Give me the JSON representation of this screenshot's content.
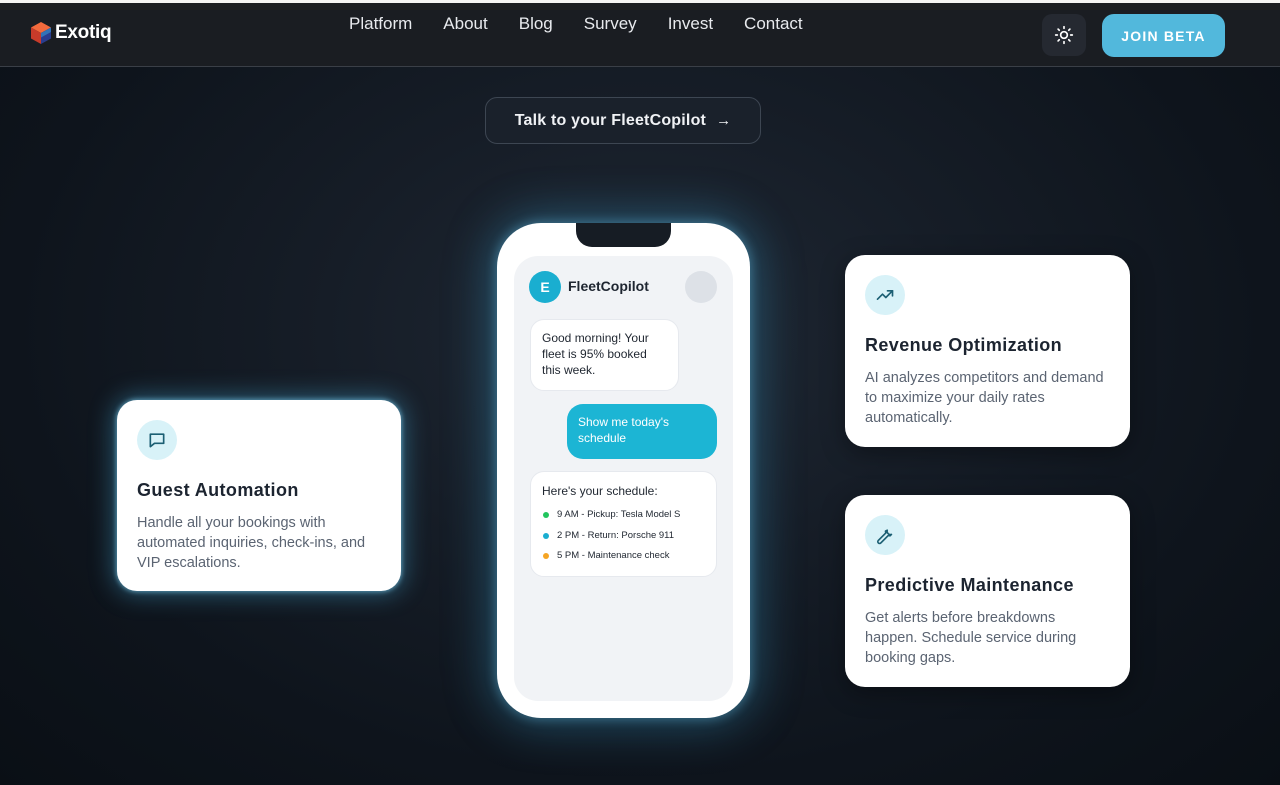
{
  "nav": {
    "brand": "Exotiq",
    "links": [
      "Platform",
      "About",
      "Blog",
      "Survey",
      "Invest",
      "Contact"
    ],
    "theme_icon": "sun-icon",
    "cta_label": "JOIN BETA"
  },
  "hero": {
    "cta_label": "Talk to your FleetCopilot",
    "cta_icon": "arrow-right-icon"
  },
  "phone": {
    "avatar_letter": "E",
    "bot_name": "FleetCopilot",
    "messages": [
      {
        "from": "bot",
        "text": "Good morning! Your fleet is 95% booked this week."
      },
      {
        "from": "user",
        "text": "Show me today's schedule"
      }
    ],
    "schedule": {
      "title": "Here's your schedule:",
      "items": [
        {
          "text": "9 AM - Pickup: Tesla Model S",
          "color": "#22c55e"
        },
        {
          "text": "2 PM - Return: Porsche 911",
          "color": "#1aaed0"
        },
        {
          "text": "5 PM - Maintenance check",
          "color": "#f5a524"
        }
      ]
    }
  },
  "features": [
    {
      "icon": "chat-bubble-icon",
      "title": "Guest Automation",
      "text": "Handle all your bookings with automated inquiries, check-ins, and VIP escalations."
    },
    {
      "icon": "trending-up-icon",
      "title": "Revenue Optimization",
      "text": "AI analyzes competitors and demand to maximize your daily rates automatically."
    },
    {
      "icon": "wrench-icon",
      "title": "Predictive Maintenance",
      "text": "Get alerts before breakdowns happen. Schedule service during booking gaps."
    }
  ],
  "colors": {
    "accent": "#1cb5d4",
    "button": "#52b8dc",
    "background": "#0e141c",
    "nav_background": "#1a1d22"
  }
}
